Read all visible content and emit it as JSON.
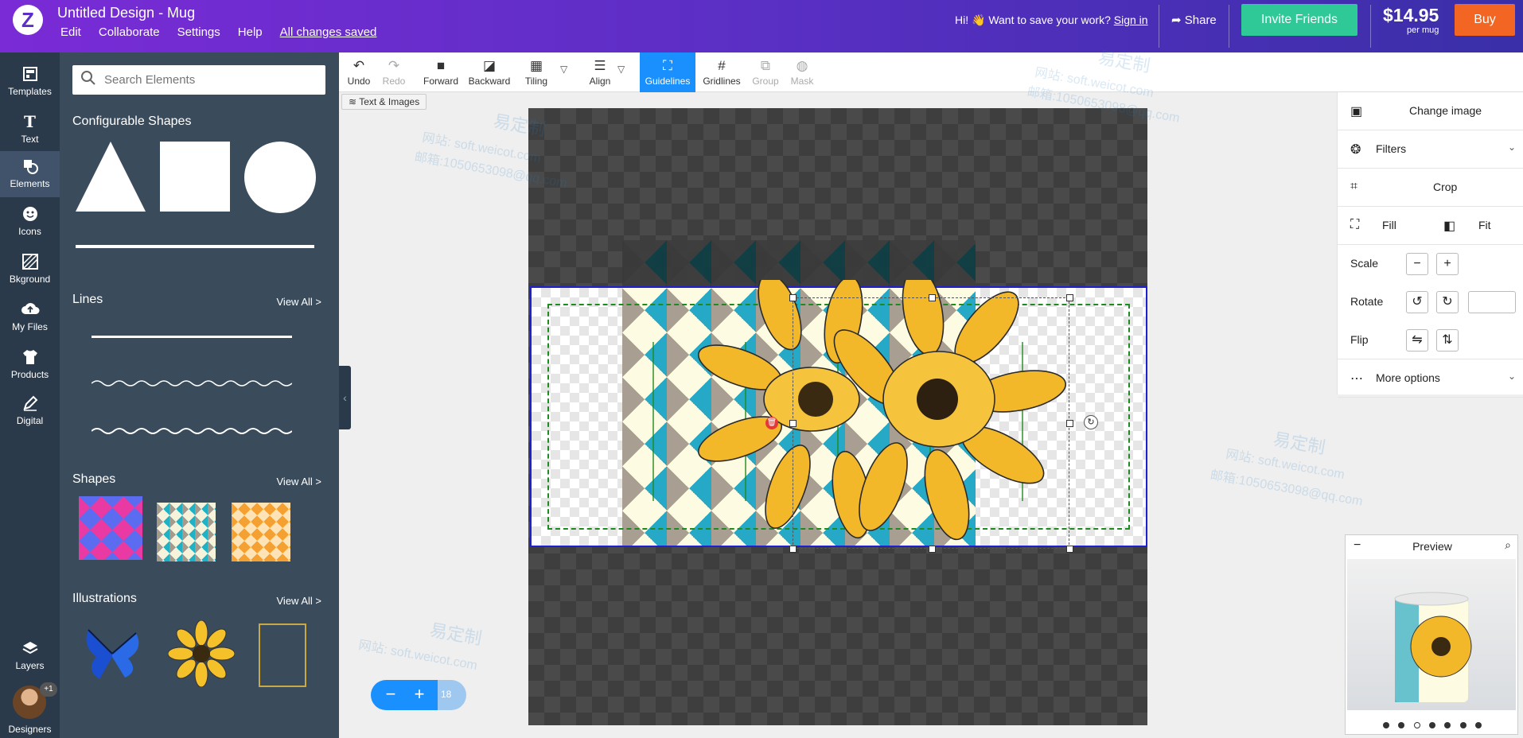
{
  "header": {
    "logo_text": "Z",
    "title": "Untitled Design - Mug",
    "menu": [
      "Edit",
      "Collaborate",
      "Settings",
      "Help"
    ],
    "saved_status": "All changes saved",
    "greeting": "Hi! 👋 Want to save your work?",
    "sign_in": "Sign in",
    "share": "Share",
    "invite": "Invite Friends",
    "price": "$14.95",
    "price_unit": "per mug",
    "buy": "Buy"
  },
  "left_nav": {
    "items": [
      {
        "label": "Templates",
        "icon": "templates-icon"
      },
      {
        "label": "Text",
        "icon": "text-icon"
      },
      {
        "label": "Elements",
        "icon": "elements-icon"
      },
      {
        "label": "Icons",
        "icon": "icons-icon"
      },
      {
        "label": "Bkground",
        "icon": "background-icon"
      },
      {
        "label": "My Files",
        "icon": "upload-cloud-icon"
      },
      {
        "label": "Products",
        "icon": "shirt-icon"
      },
      {
        "label": "Digital",
        "icon": "pen-icon"
      }
    ],
    "active": "Elements",
    "layers": "Layers",
    "designers": "Designers",
    "designers_badge": "+1"
  },
  "elements_panel": {
    "search_placeholder": "Search Elements",
    "sections": {
      "configurable": "Configurable Shapes",
      "lines": "Lines",
      "shapes": "Shapes",
      "illustrations": "Illustrations"
    },
    "view_all": "View All >"
  },
  "toolbar": {
    "tools": [
      {
        "label": "Undo",
        "icon": "undo-icon"
      },
      {
        "label": "Redo",
        "icon": "redo-icon"
      },
      {
        "label": "Forward",
        "icon": "bring-forward-icon"
      },
      {
        "label": "Backward",
        "icon": "send-backward-icon"
      },
      {
        "label": "Tiling",
        "icon": "tiling-icon"
      },
      {
        "label": "Align",
        "icon": "align-icon"
      },
      {
        "label": "Guidelines",
        "icon": "guidelines-icon"
      },
      {
        "label": "Gridlines",
        "icon": "gridlines-icon"
      },
      {
        "label": "Group",
        "icon": "group-icon"
      },
      {
        "label": "Mask",
        "icon": "mask-icon"
      }
    ],
    "active": "Guidelines",
    "disabled": [
      "Redo",
      "Group",
      "Mask"
    ],
    "text_images_button": "Text & Images"
  },
  "canvas": {
    "zoom_value": "18"
  },
  "properties": {
    "change_image": "Change image",
    "filters": "Filters",
    "crop": "Crop",
    "fill": "Fill",
    "fit": "Fit",
    "scale": "Scale",
    "rotate": "Rotate",
    "flip": "Flip",
    "more_options": "More options",
    "rotate_value": ""
  },
  "preview": {
    "title": "Preview",
    "dots_count": 7,
    "active_dot": 3
  },
  "watermark": {
    "cn": "易定制",
    "site": "网站: soft.weicot.com",
    "email": "邮箱:1050653098@qq.com"
  },
  "colors": {
    "header_gradient_start": "#7a2bd6",
    "header_gradient_end": "#3a2fa8",
    "invite_green": "#2fc998",
    "buy_orange": "#f26522",
    "active_blue": "#1a90ff",
    "nav_dark": "#2b3a4a",
    "panel_dark": "#3a4b5c",
    "print_border": "#2020d0",
    "safe_green": "#1f8a1f"
  }
}
